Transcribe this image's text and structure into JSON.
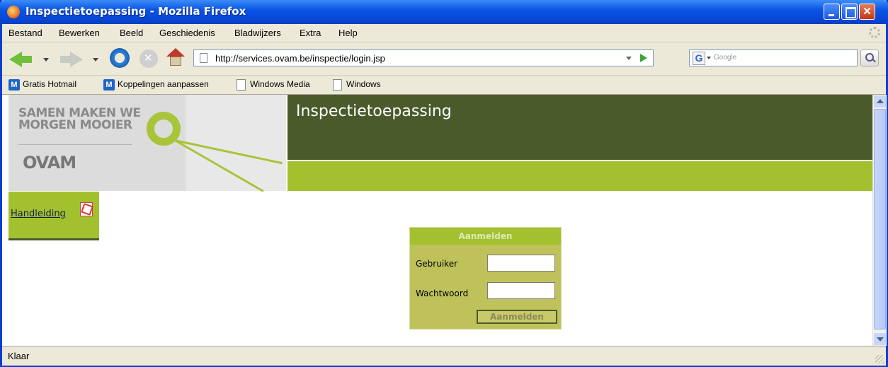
{
  "window": {
    "title": "Inspectietoepassing - Mozilla Firefox"
  },
  "menu": {
    "items": [
      "Bestand",
      "Bewerken",
      "Beeld",
      "Geschiedenis",
      "Bladwijzers",
      "Extra",
      "Help"
    ]
  },
  "navbar": {
    "url": "http://services.ovam.be/inspectie/login.jsp",
    "search_placeholder": "Google",
    "search_engine_letter": "G"
  },
  "bookmarks": {
    "items": [
      "Gratis Hotmail",
      "Koppelingen aanpassen",
      "Windows Media",
      "Windows"
    ],
    "msn_letter": "M"
  },
  "page": {
    "logo_line1": "SAMEN MAKEN WE",
    "logo_line2": "MORGEN MOOIER",
    "logo_mark": "OVAM",
    "header_title": "Inspectietoepassing",
    "handleiding_link": "Handleiding",
    "login": {
      "heading": "Aanmelden",
      "user_label": "Gebruiker",
      "password_label": "Wachtwoord",
      "user_value": "",
      "password_value": "",
      "submit_label": "Aanmelden"
    }
  },
  "status": {
    "text": "Klaar"
  },
  "colors": {
    "header_dark": "#4a5a2a",
    "header_light": "#a3c12e",
    "login_bg": "#bfc25a",
    "titlebar": "#0a55e6"
  },
  "icons": [
    "firefox-icon",
    "back-arrow-icon",
    "forward-arrow-icon",
    "reload-icon",
    "stop-icon",
    "home-icon",
    "page-icon",
    "go-arrow-icon",
    "search-magnifier-icon",
    "msn-icon",
    "document-icon",
    "pdf-icon",
    "throbber-icon"
  ]
}
